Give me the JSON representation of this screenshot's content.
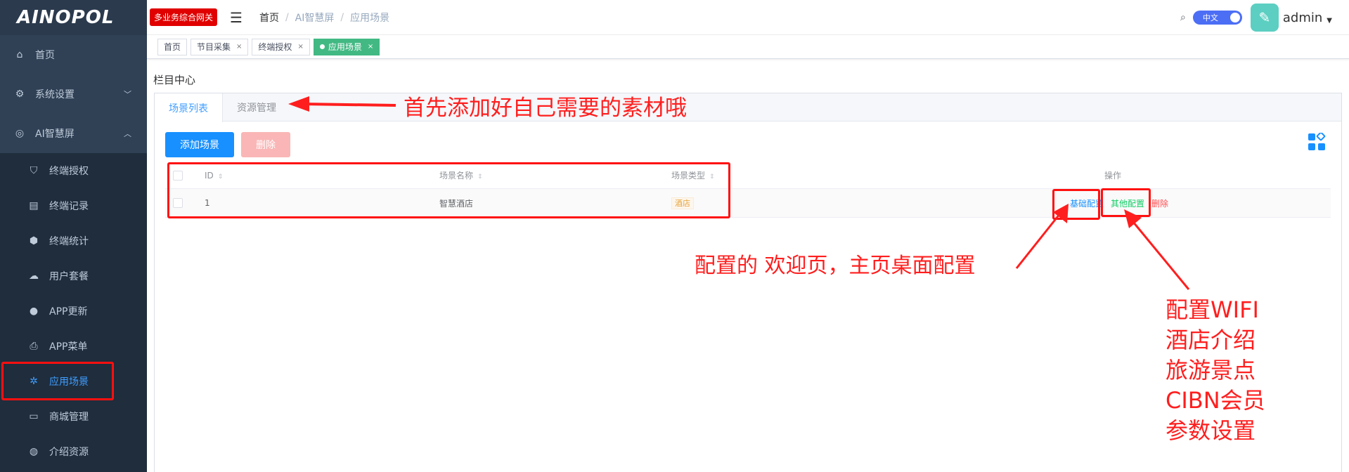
{
  "sidebar": {
    "logo": "AINOPOL",
    "items": [
      {
        "label": "首页",
        "icon": "home-icon"
      },
      {
        "label": "系统设置",
        "icon": "gear-icon"
      },
      {
        "label": "AI智慧屏",
        "icon": "screen-icon"
      },
      {
        "label": "终端授权",
        "icon": "shield-icon"
      },
      {
        "label": "终端记录",
        "icon": "record-icon"
      },
      {
        "label": "终端统计",
        "icon": "stats-icon"
      },
      {
        "label": "用户套餐",
        "icon": "package-icon"
      },
      {
        "label": "APP更新",
        "icon": "update-icon"
      },
      {
        "label": "APP菜单",
        "icon": "menu-icon"
      },
      {
        "label": "应用场景",
        "icon": "scene-icon",
        "active": true
      },
      {
        "label": "商城管理",
        "icon": "shop-icon"
      },
      {
        "label": "介绍资源",
        "icon": "globe-icon"
      }
    ]
  },
  "navbar": {
    "gateway_badge": "多业务综合网关",
    "breadcrumb": [
      "首页",
      "AI智慧屏",
      "应用场景"
    ],
    "lang": "中文",
    "username": "admin"
  },
  "tags": [
    "首页",
    "节目采集",
    "终端授权",
    "应用场景"
  ],
  "main": {
    "section_title": "栏目中心",
    "tabs": [
      "场景列表",
      "资源管理"
    ],
    "add_button": "添加场景",
    "delete_button": "删除",
    "columns": [
      "ID",
      "场景名称",
      "场景类型",
      "操作"
    ],
    "rows": [
      {
        "id": "1",
        "name": "智慧酒店",
        "type": "酒店",
        "ops": [
          "基础配置",
          "其他配置",
          "删除"
        ]
      }
    ]
  },
  "annotations": {
    "resource_note": "首先添加好自己需要的素材哦",
    "basic_note": "配置的 欢迎页，主页桌面配置",
    "other_note_lines": [
      "配置WIFI",
      "酒店介绍",
      "旅游景点",
      "CIBN会员",
      "参数设置"
    ]
  },
  "colors": {
    "sidebar_bg": "#304156",
    "accent": "#409eff",
    "annotation_red": "#ff1e1e",
    "tag_active": "#42b983"
  }
}
